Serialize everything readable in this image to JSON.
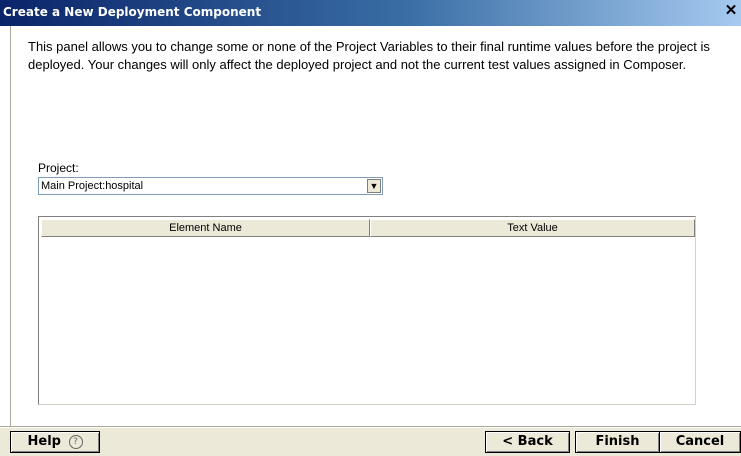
{
  "window": {
    "title": "Create a New Deployment Component",
    "close_glyph": "✕"
  },
  "panel": {
    "description": "This panel allows you to change some or none of the Project Variables to their final runtime values before the project is deployed.  Your changes will only affect the deployed project and not the current test values assigned in Composer."
  },
  "project": {
    "label": "Project:",
    "selected": "Main Project:hospital"
  },
  "table": {
    "columns": [
      "Element Name",
      "Text Value"
    ],
    "rows": []
  },
  "buttons": {
    "help": "Help",
    "help_icon": "?",
    "back": "< Back",
    "finish": "Finish",
    "cancel": "Cancel"
  }
}
